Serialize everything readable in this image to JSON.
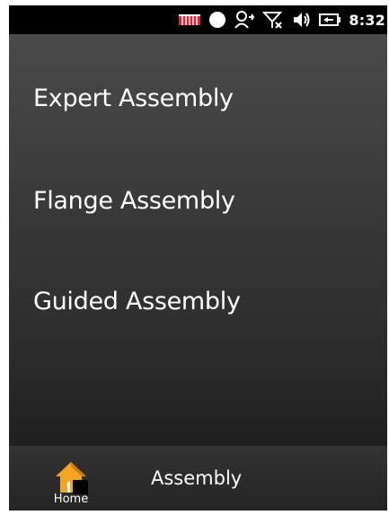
{
  "status_bar": {
    "icons": [
      "keyboard-grid-icon",
      "circle-record-icon",
      "sync-user-icon",
      "no-signal-icon",
      "volume-icon",
      "battery-icon"
    ],
    "time": "8:32"
  },
  "menu": {
    "items": [
      {
        "label": "Expert Assembly"
      },
      {
        "label": "Flange Assembly"
      },
      {
        "label": "Guided Assembly"
      }
    ]
  },
  "bottom_bar": {
    "home_label": "Home",
    "title": "Assembly"
  },
  "colors": {
    "statusbar_bg": "#000000",
    "menu_bg_top": "#4a4a4a",
    "menu_bg_bottom": "#1f1f1f",
    "text": "#ffffff",
    "home_icon_accent": "#f4a623",
    "grid_icon_red": "#d7263d"
  }
}
